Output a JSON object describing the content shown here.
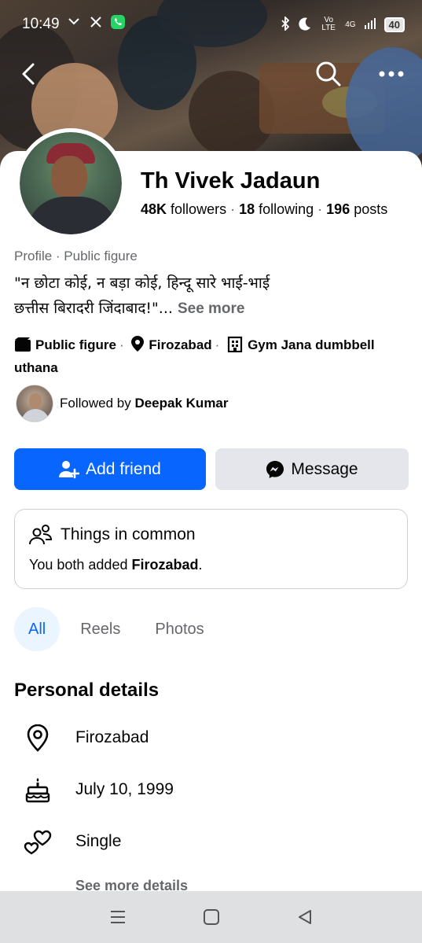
{
  "status_bar": {
    "time": "10:49",
    "network": "4G",
    "volte": "Vo LTE",
    "battery": "40"
  },
  "profile": {
    "name": "Th Vivek Jadaun",
    "followers_count": "48K",
    "followers_label": "followers",
    "following_count": "18",
    "following_label": "following",
    "posts_count": "196",
    "posts_label": "posts",
    "category": "Profile · Public figure",
    "bio_line1": "\"न छोटा कोई, न बड़ा कोई, हिन्दू सारे भाई-भाई",
    "bio_line2": " छत्तीस बिरादरी जिंदाबाद!\"...",
    "bio_see_more": "See more"
  },
  "intro": {
    "public_figure": "Public figure",
    "location": "Firozabad",
    "workplace": "Gym Jana dumbbell uthana"
  },
  "followed_by": {
    "prefix": "Followed by",
    "name": "Deepak Kumar"
  },
  "actions": {
    "add_friend": "Add friend",
    "message": "Message"
  },
  "things_in_common": {
    "title": "Things in common",
    "text_prefix": "You both added",
    "place": "Firozabad",
    "text_suffix": "."
  },
  "tabs": [
    {
      "label": "All",
      "active": true
    },
    {
      "label": "Reels",
      "active": false
    },
    {
      "label": "Photos",
      "active": false
    }
  ],
  "personal_details": {
    "title": "Personal details",
    "items": [
      {
        "icon": "location-pin-icon",
        "value": "Firozabad"
      },
      {
        "icon": "birthday-cake-icon",
        "value": "July 10, 1999"
      },
      {
        "icon": "hearts-icon",
        "value": "Single"
      }
    ],
    "see_more": "See more details"
  },
  "colors": {
    "accent": "#0866ff",
    "secondary_button": "#e4e6eb",
    "muted_text": "#65676b",
    "active_tab_bg": "#ebf5ff"
  }
}
